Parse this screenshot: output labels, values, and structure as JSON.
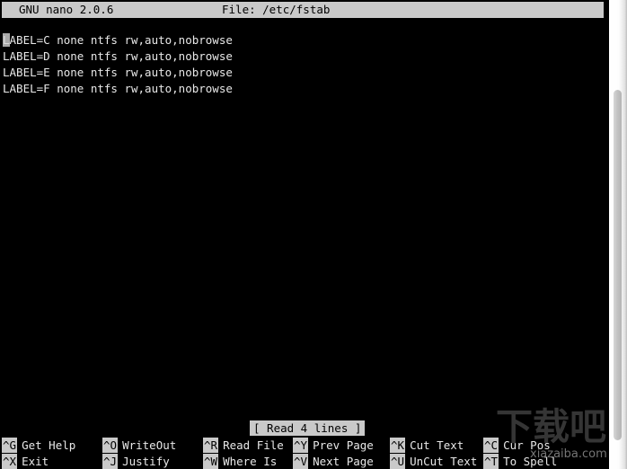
{
  "window": {
    "app": "GNU nano",
    "background_color": "#000000",
    "foreground_color": "#e8e8e8",
    "accent_color": "#c9c9c9"
  },
  "title_bar": {
    "version_label": "GNU nano 2.0.6",
    "file_label": "File: /etc/fstab"
  },
  "editor": {
    "lines": [
      "LABEL=C none ntfs rw,auto,nobrowse",
      "LABEL=D none ntfs rw,auto,nobrowse",
      "LABEL=E none ntfs rw,auto,nobrowse",
      "LABEL=F none ntfs rw,auto,nobrowse"
    ],
    "cursor_line": 1,
    "cursor_column": 1
  },
  "status": {
    "message": "[ Read 4 lines ]"
  },
  "help_bar": {
    "columns": [
      {
        "top": {
          "key": "^G",
          "label": "Get Help"
        },
        "bottom": {
          "key": "^X",
          "label": "Exit"
        }
      },
      {
        "top": {
          "key": "^O",
          "label": "WriteOut"
        },
        "bottom": {
          "key": "^J",
          "label": "Justify"
        }
      },
      {
        "top": {
          "key": "^R",
          "label": "Read File"
        },
        "bottom": {
          "key": "^W",
          "label": "Where Is"
        }
      },
      {
        "top": {
          "key": "^Y",
          "label": "Prev Page"
        },
        "bottom": {
          "key": "^V",
          "label": "Next Page"
        }
      },
      {
        "top": {
          "key": "^K",
          "label": "Cut Text"
        },
        "bottom": {
          "key": "^U",
          "label": "UnCut Text"
        }
      },
      {
        "top": {
          "key": "^C",
          "label": "Cur Pos"
        },
        "bottom": {
          "key": "^T",
          "label": "To Spell"
        }
      }
    ]
  },
  "scrollbar": {
    "orientation": "vertical"
  },
  "watermark": {
    "cjk_text": "下载吧",
    "url_text": "xiazaiba.com"
  }
}
